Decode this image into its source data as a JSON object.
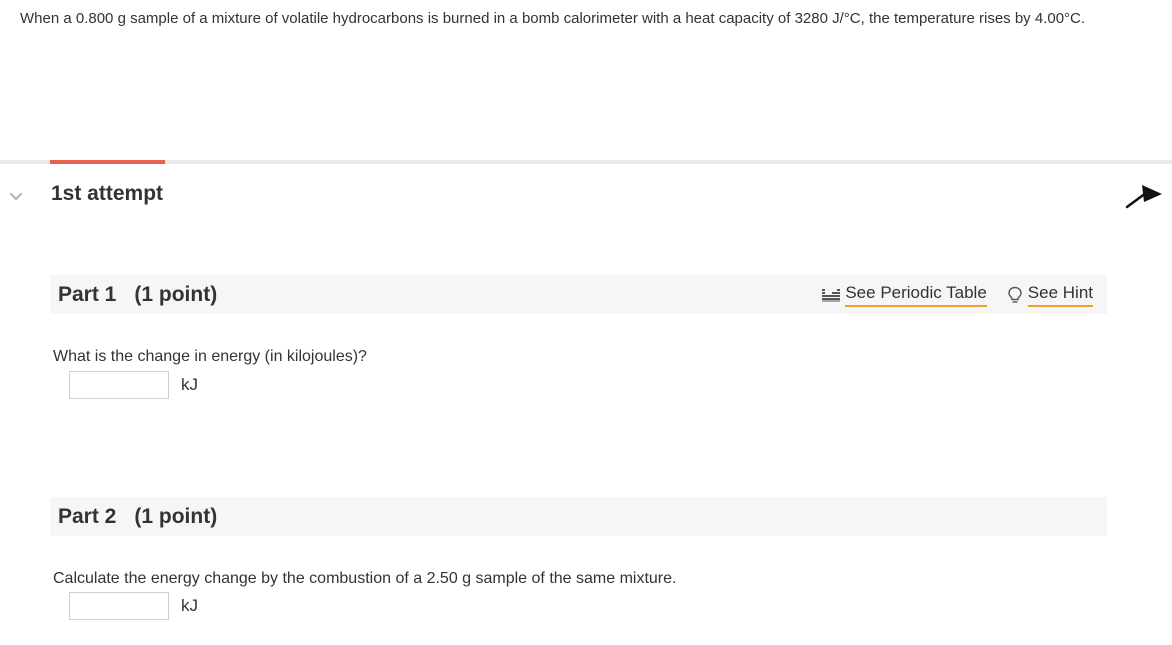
{
  "problem": {
    "text": "When a 0.800 g sample of a mixture of volatile hydrocarbons is burned in a bomb calorimeter with a heat capacity of 3280 J/°C, the temperature rises by 4.00°C."
  },
  "attempt": {
    "label": "1st attempt",
    "progress_color": "#e5634d"
  },
  "tools": {
    "periodic_table": "See Periodic Table",
    "hint": "See Hint"
  },
  "parts": [
    {
      "name": "Part 1",
      "points": "(1 point)",
      "question": "What is the change in energy (in kilojoules)?",
      "answer_value": "",
      "unit": "kJ"
    },
    {
      "name": "Part 2",
      "points": "(1 point)",
      "question": "Calculate the energy change by the combustion of a 2.50 g sample of the same mixture.",
      "answer_value": "",
      "unit": "kJ"
    }
  ],
  "icons": {
    "chevron": "chevron-down-icon",
    "pin": "pin-icon",
    "periodic_table": "periodic-table-icon",
    "hint": "lightbulb-icon"
  }
}
